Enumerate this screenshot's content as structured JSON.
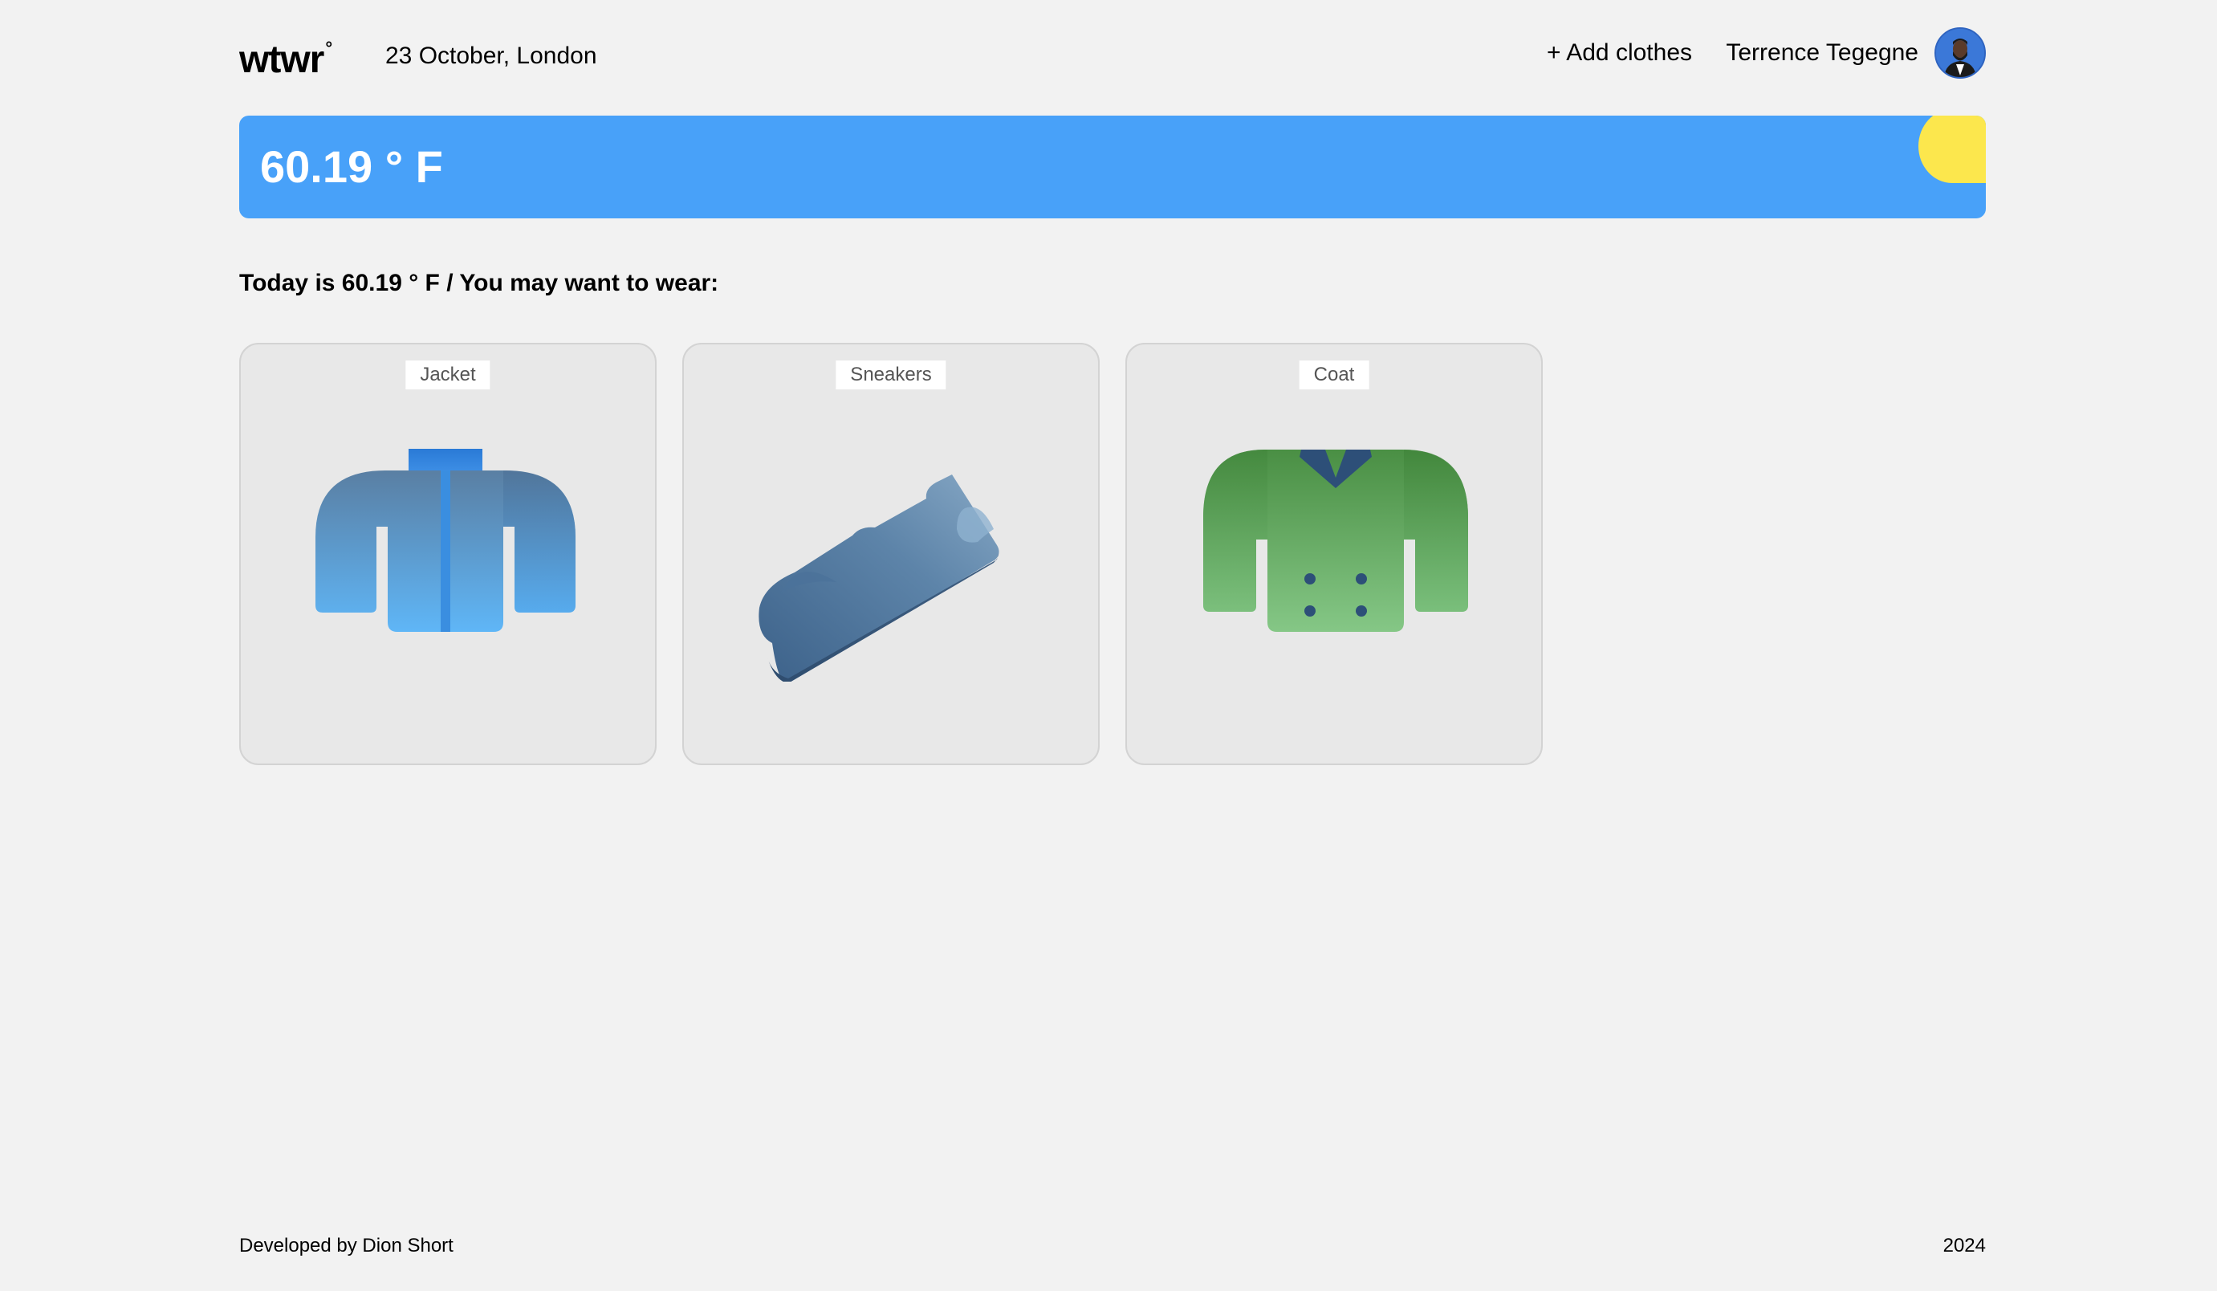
{
  "header": {
    "logo_text": "wtwr",
    "logo_mark": "°",
    "date_location": "23 October, London",
    "add_clothes_label": "+ Add clothes",
    "username": "Terrence Tegegne",
    "avatar_icon": "user-avatar"
  },
  "weather": {
    "temperature": "60.19 ° F",
    "condition_icon": "sun-icon",
    "colors": {
      "banner": "#48a1f9",
      "sun": "#fce74d"
    }
  },
  "recommendation": {
    "text": "Today is 60.19 ° F / You may want to wear:"
  },
  "items": [
    {
      "name": "Jacket",
      "icon": "jacket-icon"
    },
    {
      "name": "Sneakers",
      "icon": "sneakers-icon"
    },
    {
      "name": "Coat",
      "icon": "coat-icon"
    }
  ],
  "footer": {
    "developer": "Developed by Dion Short",
    "year": "2024"
  }
}
